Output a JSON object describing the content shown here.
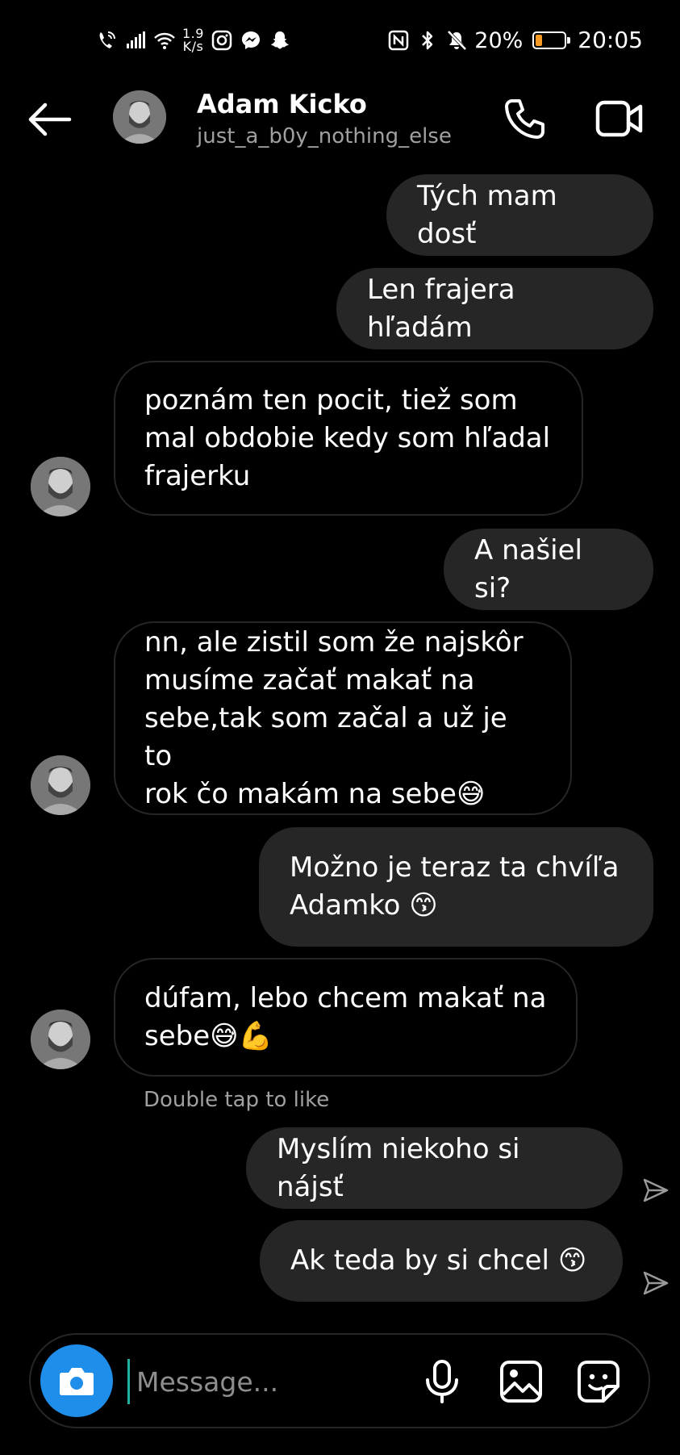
{
  "status_bar": {
    "netspeed_value": "1.9",
    "netspeed_unit": "K/s",
    "battery_percent": "20%",
    "battery_level": 0.2,
    "battery_color": "#f59a23",
    "time": "20:05",
    "left_icons": [
      "wifi-calling-icon",
      "signal-icon",
      "wifi-icon",
      "instagram-icon",
      "messenger-icon",
      "snapchat-icon"
    ],
    "right_icons": [
      "nfc-icon",
      "bluetooth-icon",
      "muted-bell-icon",
      "battery-icon"
    ]
  },
  "header": {
    "contact_name": "Adam Kicko",
    "username": "just_a_b0y_nothing_else",
    "icons": [
      "back-arrow-icon",
      "phone-icon",
      "video-camera-icon"
    ]
  },
  "messages": [
    {
      "from": "me",
      "text": "Tých mam dosť"
    },
    {
      "from": "me",
      "text": "Len frajera hľadám"
    },
    {
      "from": "them",
      "lines": [
        "poznám ten pocit, tiež som",
        "mal obdobie kedy som hľadal",
        "frajerku"
      ]
    },
    {
      "from": "me",
      "text": "A našiel si?"
    },
    {
      "from": "them",
      "lines": [
        "nn, ale zistil som že najskôr",
        "musíme začať makať na",
        "sebe,tak som začal a už je to",
        "rok čo makám na sebe😅"
      ]
    },
    {
      "from": "me",
      "lines": [
        "Možno je teraz ta chvíľa",
        "Adamko 😙"
      ]
    },
    {
      "from": "them",
      "lines": [
        "dúfam, lebo chcem makať na",
        "sebe😅💪"
      ]
    },
    {
      "from": "me",
      "text": "Myslím niekoho si nájsť",
      "sent_icon": "send-arrow-icon"
    },
    {
      "from": "me",
      "text": "Ak teda by si chcel 😙",
      "sent_icon": "send-arrow-icon"
    }
  ],
  "hint_text": "Double tap to like",
  "composer": {
    "placeholder": "Message...",
    "camera_button_color": "#1f8eea",
    "icons": [
      "camera-icon",
      "microphone-icon",
      "gallery-icon",
      "sticker-icon"
    ]
  }
}
